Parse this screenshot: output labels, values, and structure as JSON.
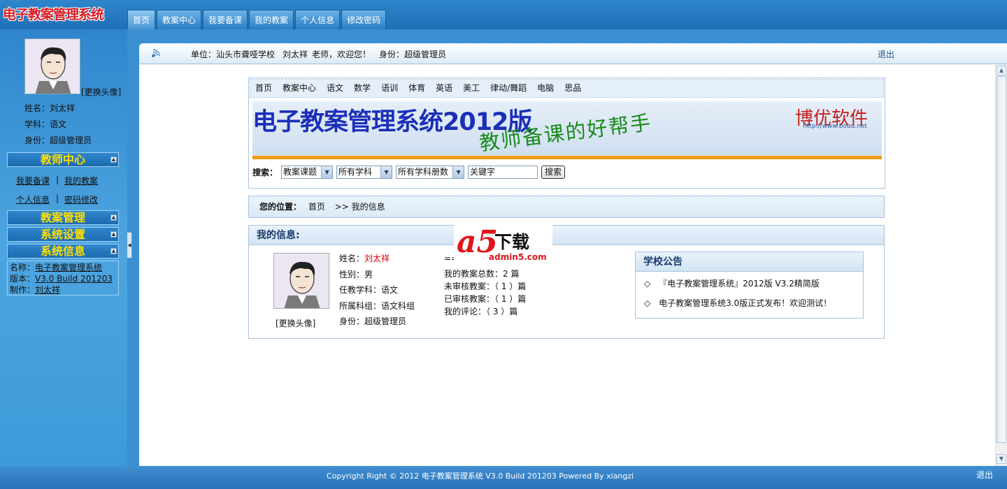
{
  "app": {
    "logo_text": "电子教案管理系统"
  },
  "top_nav": [
    "首页",
    "教案中心",
    "我要备课",
    "我的教案",
    "个人信息",
    "修改密码"
  ],
  "sidebar": {
    "change_avatar": "[更换头像]",
    "name_line": "姓名：刘太祥",
    "subject_line": "学科：语文",
    "role_line": "身份：超级管理员",
    "section_teacher": "教师中心",
    "links": {
      "prepare": "我要备课",
      "my_plans": "我的教案",
      "personal": "个人信息",
      "password": "密码修改",
      "separator": "|"
    },
    "section_plans": "教案管理",
    "section_settings": "系统设置",
    "section_info": "系统信息",
    "toggle_glyph": "▲",
    "sysinfo": {
      "name_label": "名称：",
      "name_value": "电子教案管理系统",
      "version_label": "版本：",
      "version_value": "V3.0 Build 201203",
      "author_label": "制作：",
      "author_value": "刘太祥"
    },
    "collapse_glyph": "◀"
  },
  "infobar": {
    "unit": "单位：汕头市聋哑学校",
    "user_name": "刘太祥",
    "greeting": "老师，欢迎您！",
    "role_label": "身份：",
    "role_value": "超级管理员",
    "logout": "退出"
  },
  "inner_nav": [
    "首页",
    "教案中心",
    "语文",
    "数学",
    "语训",
    "体育",
    "英语",
    "美工",
    "律动/舞蹈",
    "电脑",
    "思品"
  ],
  "banner": {
    "title": "电子教案管理系统2012版",
    "slogan": "教师备课的好帮手",
    "brand": "博优软件",
    "url": "http://www.bouu.net"
  },
  "search": {
    "label": "搜索：",
    "type_selected": "教案课题",
    "subject_selected": "所有学科",
    "volume_selected": "所有学科册数",
    "keyword_value": "关键字",
    "button": "搜索"
  },
  "breadcrumb": {
    "label": "您的位置：",
    "home": "首页",
    "current": ">> 我的信息"
  },
  "my_info": {
    "title": "我的信息:",
    "change_avatar": "[更换头像]",
    "name_label": "姓名：",
    "name_value": "刘太祥",
    "gender": "性别：男",
    "subject": "任教学科：语文",
    "group": "所属科组：语文科组",
    "role": "身份：超级管理员",
    "eq": "==",
    "total_plans": "我的教案总数：2 篇",
    "unreviewed": "未审核教案：（ 1 ）篇",
    "reviewed": "已审核教案：（ 1 ）篇",
    "comments": "我的评论：（ 3 ）篇"
  },
  "notice": {
    "title": "学校公告",
    "items": [
      "『电子教案管理系统』2012版 V3.2精简版",
      "电子教案管理系统3.0版正式发布！欢迎测试！"
    ],
    "bullet": "◇"
  },
  "watermark": {
    "a5": "a5",
    "text": "下载",
    "url": "admin5.com"
  },
  "scrollbar": {
    "up": "▲",
    "down": "▼"
  },
  "footer": {
    "copyright": "Copyright Right © 2012  电子教案管理系统 V3.0 Build 201203  Powered By xiangzi",
    "logout": "退出"
  },
  "colors": {
    "header_blue": "#2f86cc",
    "highlight_red": "#dd0000",
    "section_yellow": "#ffe000",
    "banner_title": "#1b2fb8",
    "banner_slogan": "#1a8a1a",
    "accent_orange": "#f39c12"
  }
}
